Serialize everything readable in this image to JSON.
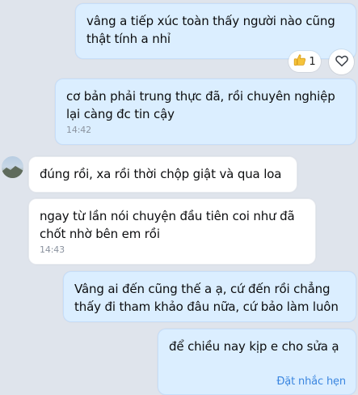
{
  "messages": [
    {
      "id": "m1",
      "text": "vâng a tiếp xúc toàn thấy người nào cũng thật tính a nhỉ"
    },
    {
      "id": "m2",
      "text": "cơ bản phải trung thực đã, rồi chuyên nghiệp lại càng đc tin cậy",
      "time": "14:42"
    },
    {
      "id": "m3",
      "text": "đúng rồi, xa rồi thời chộp giật và qua loa"
    },
    {
      "id": "m4",
      "text": "ngay từ lần nói chuyện đầu tiên coi như đã chốt nhờ bên em rồi",
      "time": "14:43"
    },
    {
      "id": "m5",
      "text": "Vâng ai đến cũng thế a ạ, cứ đến rồi chẳng thấy đi tham khảo đâu nữa, cứ bảo làm luôn"
    },
    {
      "id": "m6",
      "text": "để chiều nay kịp e cho sửa ạ",
      "action": "Đặt nhắc hẹn"
    }
  ],
  "reaction": {
    "icon": "thumbs-up-icon",
    "count": "1"
  },
  "react_button_icon": "heart-outline-icon",
  "colors": {
    "outgoing": "#dbeeff",
    "incoming": "#ffffff",
    "background": "#dfe4ec",
    "link": "#3b86e0"
  }
}
